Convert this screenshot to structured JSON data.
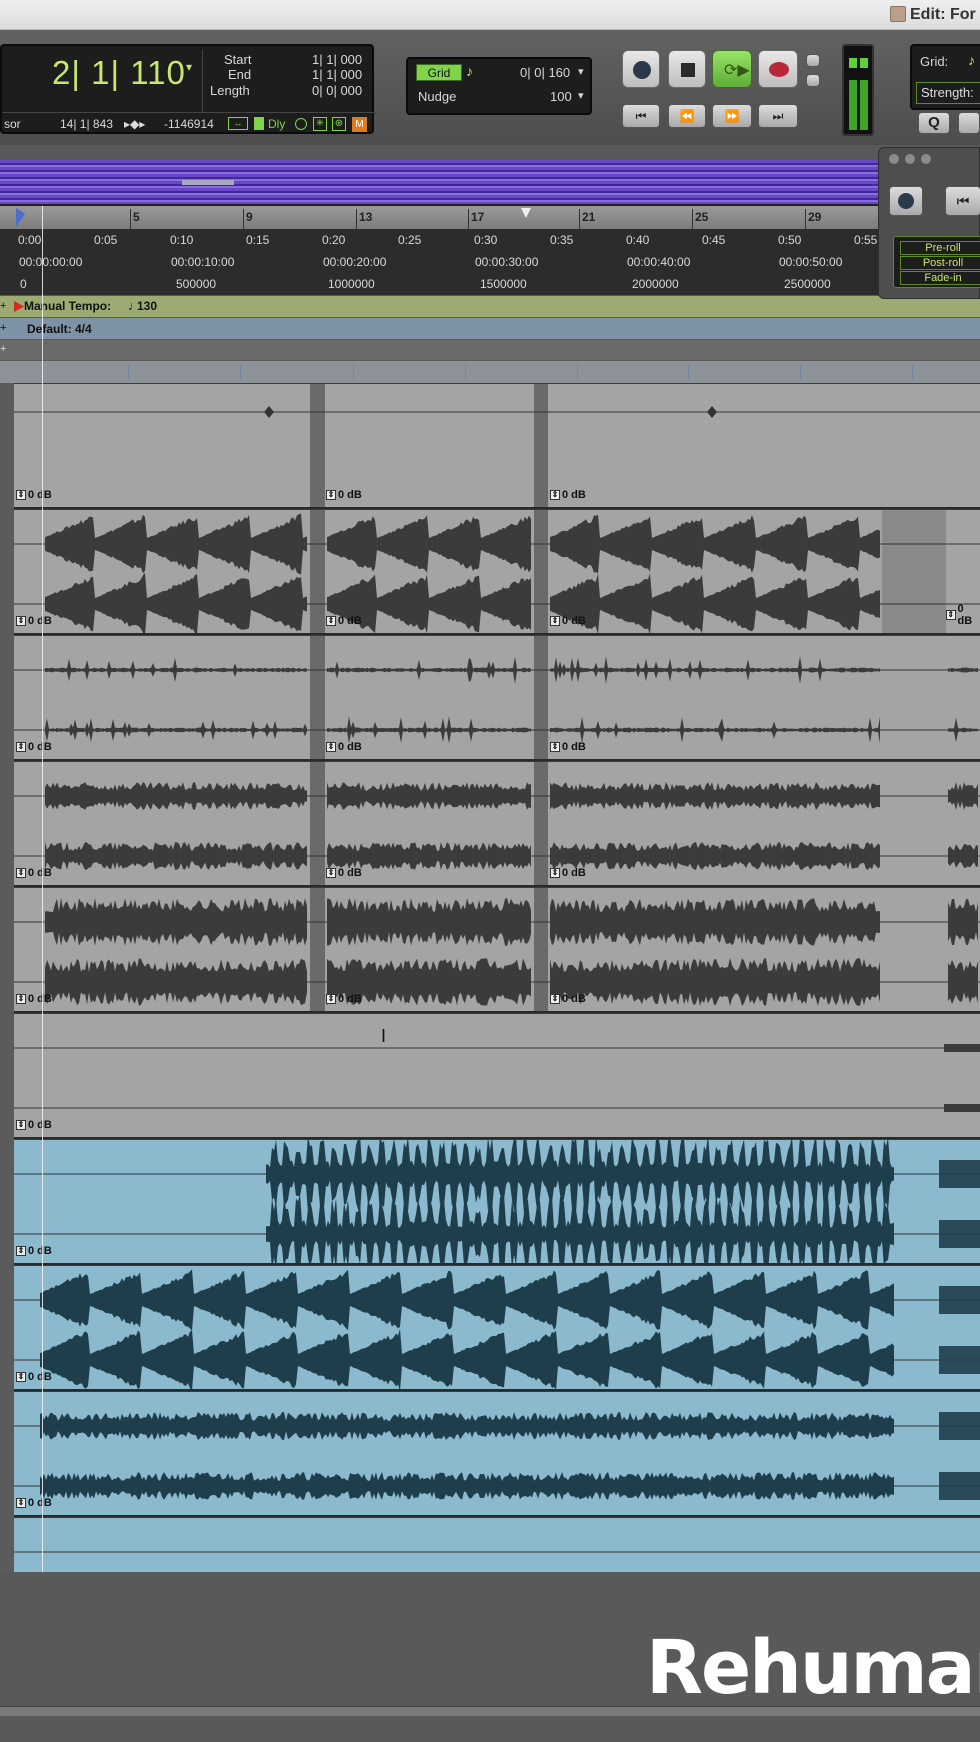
{
  "window": {
    "title": "Edit: For"
  },
  "counter": {
    "main": "2| 1| 110",
    "sub_label": "sor",
    "sub_value": "14| 1| 843",
    "sample_value": "-1146914",
    "delay_label": "Dly",
    "start_label": "Start",
    "start_value": "1| 1| 000",
    "end_label": "End",
    "end_value": "1| 1| 000",
    "length_label": "Length",
    "length_value": "0| 0| 000"
  },
  "grid": {
    "label": "Grid",
    "value": "0| 0| 160",
    "nudge_label": "Nudge",
    "nudge_value": "100"
  },
  "transport": {
    "buttons": [
      "online",
      "stop",
      "play",
      "record",
      "return-to-zero",
      "rewind",
      "fast-forward",
      "go-to-end"
    ]
  },
  "quantize": {
    "grid_label": "Grid:",
    "strength_label": "Strength:",
    "q_label": "Q"
  },
  "preroll": {
    "pre": "Pre-roll",
    "post": "Post-roll",
    "fade": "Fade-in"
  },
  "ruler": {
    "bars": [
      "5",
      "9",
      "13",
      "17",
      "21",
      "25",
      "29"
    ],
    "mins_secs": [
      "0:00",
      "0:05",
      "0:10",
      "0:15",
      "0:20",
      "0:25",
      "0:30",
      "0:35",
      "0:40",
      "0:45",
      "0:50",
      "0:55"
    ],
    "timecode": [
      "00:00:00:00",
      "00:00:10:00",
      "00:00:20:00",
      "00:00:30:00",
      "00:00:40:00",
      "00:00:50:00"
    ],
    "samples": [
      "0",
      "500000",
      "1000000",
      "1500000",
      "2000000",
      "2500000"
    ]
  },
  "tempo": {
    "label": "Manual Tempo:",
    "value": "130"
  },
  "meter": {
    "label": "Default: 4/4"
  },
  "gain_label": "0 dB",
  "tracks": [
    {
      "color": "gray"
    },
    {
      "color": "gray"
    },
    {
      "color": "gray"
    },
    {
      "color": "gray"
    },
    {
      "color": "gray"
    },
    {
      "color": "gray"
    },
    {
      "color": "blue"
    },
    {
      "color": "blue"
    },
    {
      "color": "blue"
    },
    {
      "color": "blue"
    }
  ],
  "logo": "Rehuman",
  "colors": {
    "lcd_green": "#c7e86c",
    "active_green": "#7fd44c",
    "track_blue": "#8bb9cd",
    "track_gray": "#a4a4a4",
    "wave_dark": "#3b3b3b",
    "wave_blue": "#1f3e4c"
  }
}
